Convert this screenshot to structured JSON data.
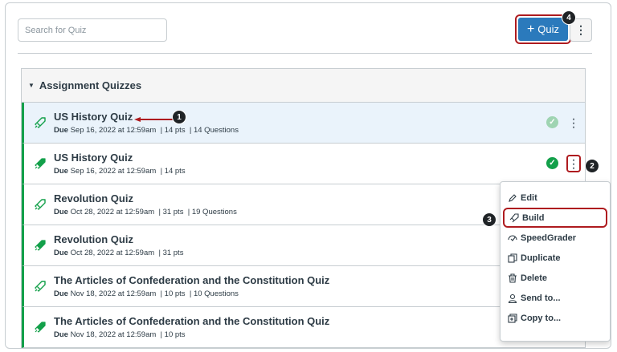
{
  "search": {
    "placeholder": "Search for Quiz"
  },
  "toolbar": {
    "add_quiz_label": "Quiz",
    "plus_glyph": "+",
    "kebab_glyph": "⋮"
  },
  "group": {
    "title": "Assignment Quizzes"
  },
  "quizzes": [
    {
      "title": "US History Quiz",
      "due_label": "Due",
      "due": "Sep 16, 2022 at 12:59am",
      "pts": "14 pts",
      "questions": "14 Questions",
      "published": "faded"
    },
    {
      "title": "US History Quiz",
      "due_label": "Due",
      "due": "Sep 16, 2022 at 12:59am",
      "pts": "14 pts",
      "questions": "",
      "published": "solid"
    },
    {
      "title": "Revolution Quiz",
      "due_label": "Due",
      "due": "Oct 28, 2022 at 12:59am",
      "pts": "31 pts",
      "questions": "19 Questions",
      "published": ""
    },
    {
      "title": "Revolution Quiz",
      "due_label": "Due",
      "due": "Oct 28, 2022 at 12:59am",
      "pts": "31 pts",
      "questions": "",
      "published": ""
    },
    {
      "title": "The Articles of Confederation and the Constitution Quiz",
      "due_label": "Due",
      "due": "Nov 18, 2022 at 12:59am",
      "pts": "10 pts",
      "questions": "10 Questions",
      "published": ""
    },
    {
      "title": "The Articles of Confederation and the Constitution Quiz",
      "due_label": "Due",
      "due": "Nov 18, 2022 at 12:59am",
      "pts": "10 pts",
      "questions": "",
      "published": ""
    }
  ],
  "menu": {
    "items": [
      {
        "label": "Edit",
        "icon": "pencil-icon"
      },
      {
        "label": "Build",
        "icon": "rocket-icon"
      },
      {
        "label": "SpeedGrader",
        "icon": "speedgrader-icon"
      },
      {
        "label": "Duplicate",
        "icon": "duplicate-icon"
      },
      {
        "label": "Delete",
        "icon": "trash-icon"
      },
      {
        "label": "Send to...",
        "icon": "user-icon"
      },
      {
        "label": "Copy to...",
        "icon": "copy-icon"
      }
    ]
  },
  "callouts": {
    "one": "1",
    "two": "2",
    "three": "3",
    "four": "4"
  },
  "colors": {
    "accent": "#2b7abc",
    "callout_outline": "#ae1b1f",
    "publish_green": "#13a04a",
    "row_highlight": "#eaf3fb"
  }
}
